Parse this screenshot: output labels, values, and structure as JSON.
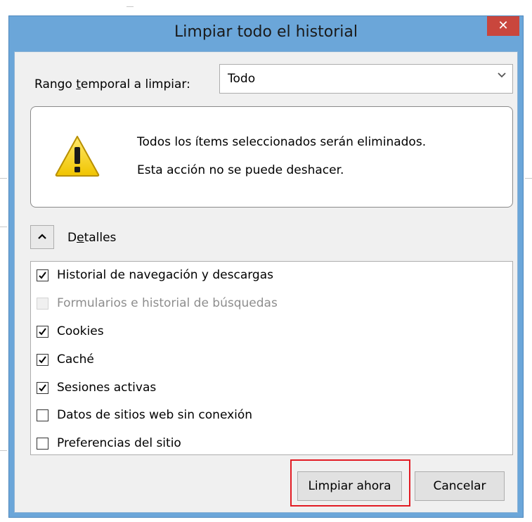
{
  "dialog": {
    "title": "Limpiar todo el historial",
    "close_glyph": "✕"
  },
  "range": {
    "label_prefix": "Rango ",
    "label_accel": "t",
    "label_suffix": "emporal a limpiar:",
    "selected": "Todo",
    "arrow_glyph": "⌄"
  },
  "warning": {
    "icon": "warning-triangle-icon",
    "line1": "Todos los ítems seleccionados serán eliminados.",
    "line2": "Esta acción no se puede deshacer."
  },
  "details": {
    "label_prefix": "D",
    "label_accel": "e",
    "label_suffix": "talles",
    "expanded": true
  },
  "items": [
    {
      "label": "Historial de navegación y descargas",
      "checked": true,
      "enabled": true
    },
    {
      "label": "Formularios e historial de búsquedas",
      "checked": false,
      "enabled": false
    },
    {
      "label": "Cookies",
      "checked": true,
      "enabled": true
    },
    {
      "label": "Caché",
      "checked": true,
      "enabled": true
    },
    {
      "label": "Sesiones activas",
      "checked": true,
      "enabled": true
    },
    {
      "label": "Datos de sitios web sin conexión",
      "checked": false,
      "enabled": true
    },
    {
      "label": "Preferencias del sitio",
      "checked": false,
      "enabled": true
    }
  ],
  "buttons": {
    "clear_now": "Limpiar ahora",
    "cancel": "Cancelar"
  },
  "colors": {
    "frame": "#6ba6d9",
    "close": "#c9463d",
    "highlight": "#e21b23"
  }
}
